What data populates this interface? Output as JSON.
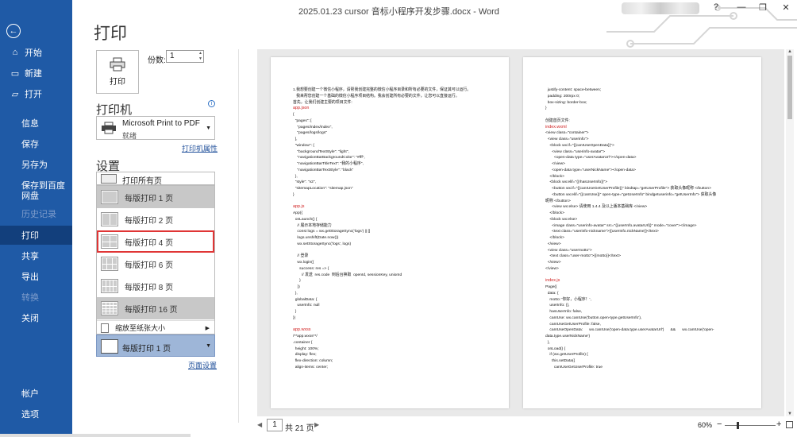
{
  "window": {
    "title": "2025.01.23  cursor 音标小程序开发步骤.docx  -  Word",
    "help": "?",
    "minimize": "—",
    "restore": "❐",
    "close": "✕"
  },
  "sidebar": {
    "back": "←",
    "items": [
      {
        "label": "开始",
        "icon": "home-icon",
        "glyph": "⌂"
      },
      {
        "label": "新建",
        "icon": "new-doc-icon",
        "glyph": "▭"
      },
      {
        "label": "打开",
        "icon": "folder-icon",
        "glyph": "▱"
      },
      {
        "label": "信息"
      },
      {
        "label": "保存"
      },
      {
        "label": "另存为"
      },
      {
        "label": "保存到百度网盘"
      },
      {
        "label": "历史记录"
      },
      {
        "label": "打印"
      },
      {
        "label": "共享"
      },
      {
        "label": "导出"
      },
      {
        "label": "转换"
      },
      {
        "label": "关闭"
      },
      {
        "label": "帐户"
      },
      {
        "label": "选项"
      }
    ]
  },
  "print": {
    "title": "打印",
    "button": "打印",
    "copies_label": "份数:",
    "copies_value": "1",
    "printer_section": "打印机",
    "printer_name": "Microsoft Print to PDF",
    "printer_status": "就绪",
    "printer_props": "打印机属性",
    "settings_section": "设置",
    "print_all": "打印所有页",
    "pages_per_sheet": [
      {
        "label": "每版打印 1 页",
        "grid": [
          1,
          1
        ]
      },
      {
        "label": "每版打印 2 页",
        "grid": [
          2,
          1
        ]
      },
      {
        "label": "每版打印 4 页",
        "grid": [
          2,
          2
        ]
      },
      {
        "label": "每版打印 6 页",
        "grid": [
          3,
          2
        ]
      },
      {
        "label": "每版打印 8 页",
        "grid": [
          4,
          2
        ]
      },
      {
        "label": "每版打印 16 页",
        "grid": [
          4,
          4
        ]
      }
    ],
    "selected_option": "每版打印 4 页",
    "scale_option": "缩放至纸张大小",
    "current_selection": "每版打印 1 页",
    "page_setup": "页面设置"
  },
  "preview": {
    "left_page": [
      {
        "t": "1.我想要创建一个微信小程序，请帮我创建完整的微信小程序目录和所有必要的文件，保证其可以运行。",
        "h": false
      },
      {
        "t": "   我来帮您创建一个基础的微信小程序项目结构。我会创建所有必要的文件，让您可以直接运行。",
        "h": false
      },
      {
        "t": "首先，让我们创建主要的项目文件:",
        "h": false
      },
      {
        "t": "app.json",
        "h": true
      },
      {
        "t": "{",
        "h": false
      },
      {
        "t": "  \"pages\": [",
        "h": false
      },
      {
        "t": "    \"pages/index/index\",",
        "h": false
      },
      {
        "t": "    \"pages/logs/logs\"",
        "h": false
      },
      {
        "t": "  ],",
        "h": false
      },
      {
        "t": "  \"window\": {",
        "h": false
      },
      {
        "t": "    \"backgroundTextStyle\": \"light\",",
        "h": false
      },
      {
        "t": "    \"navigationBarBackgroundColor\": \"#fff\",",
        "h": false
      },
      {
        "t": "    \"navigationBarTitleText\": \"我的小程序\",",
        "h": false
      },
      {
        "t": "    \"navigationBarTextStyle\": \"black\"",
        "h": false
      },
      {
        "t": "  },",
        "h": false
      },
      {
        "t": "  \"style\": \"v2\",",
        "h": false
      },
      {
        "t": "  \"sitemapLocation\": \"sitemap.json\"",
        "h": false
      },
      {
        "t": "}",
        "h": false
      },
      {
        "t": "",
        "h": false
      },
      {
        "t": "app.js",
        "h": true
      },
      {
        "t": "App({",
        "h": false
      },
      {
        "t": "  onLaunch() {",
        "h": false
      },
      {
        "t": "    // 展示本地存储能力",
        "h": false
      },
      {
        "t": "    const logs = wx.getStorageSync('logs') || []",
        "h": false
      },
      {
        "t": "    logs.unshift(Date.now())",
        "h": false
      },
      {
        "t": "    wx.setStorageSync('logs', logs)",
        "h": false
      },
      {
        "t": "",
        "h": false
      },
      {
        "t": "    // 登录",
        "h": false
      },
      {
        "t": "    wx.login({",
        "h": false
      },
      {
        "t": "      success: res => {",
        "h": false
      },
      {
        "t": "        // 发送  res.code  到后台换取  openId, sessionKey, unionId",
        "h": false
      },
      {
        "t": "      }",
        "h": false
      },
      {
        "t": "    })",
        "h": false
      },
      {
        "t": "  },",
        "h": false
      },
      {
        "t": "  globalData: {",
        "h": false
      },
      {
        "t": "    userInfo: null",
        "h": false
      },
      {
        "t": "  }",
        "h": false
      },
      {
        "t": "})",
        "h": false
      },
      {
        "t": "",
        "h": false
      },
      {
        "t": "app.wxss",
        "h": true
      },
      {
        "t": "/**app.wxss**/",
        "h": false
      },
      {
        "t": ".container {",
        "h": false
      },
      {
        "t": "  height: 100%;",
        "h": false
      },
      {
        "t": "  display: flex;",
        "h": false
      },
      {
        "t": "  flex-direction: column;",
        "h": false
      },
      {
        "t": "  align-items: center;",
        "h": false
      }
    ],
    "right_page": [
      {
        "t": "  justify-content: space-between;",
        "h": false
      },
      {
        "t": "  padding: 200rpx 0;",
        "h": false
      },
      {
        "t": "  box-sizing: border-box;",
        "h": false
      },
      {
        "t": "}",
        "h": false
      },
      {
        "t": "",
        "h": false
      },
      {
        "t": "创建首页文件:",
        "h": false
      },
      {
        "t": "index.wxml",
        "h": true
      },
      {
        "t": "<view class=\"container\">",
        "h": false
      },
      {
        "t": "  <view class=\"userinfo\">",
        "h": false
      },
      {
        "t": "    <block wx:if=\"{{canIUseOpenData}}\">",
        "h": false
      },
      {
        "t": "      <view class=\"userinfo-avatar\">",
        "h": false
      },
      {
        "t": "        <open-data type=\"userAvatarUrl\"></open-data>",
        "h": false
      },
      {
        "t": "      </view>",
        "h": false
      },
      {
        "t": "      <open-data type=\"userNickName\"></open-data>",
        "h": false
      },
      {
        "t": "    </block>",
        "h": false
      },
      {
        "t": "    <block wx:elif=\"{{!hasUserInfo}}\">",
        "h": false
      },
      {
        "t": "      <button wx:if=\"{{canIUseGetUserProfile}}\" bindtap=\"getUserProfile\"> 获取头像昵称 </button>",
        "h": false
      },
      {
        "t": "      <button wx:elif=\"{{canIUse}}\" open-type=\"getUserInfo\" bindgetuserinfo=\"getUserInfo\"> 获取头像",
        "h": false
      },
      {
        "t": "昵称 </button>",
        "h": false
      },
      {
        "t": "      <view wx:else> 请使用 1.4.4 及以上版本基础库 </view>",
        "h": false
      },
      {
        "t": "    </block>",
        "h": false
      },
      {
        "t": "    <block wx:else>",
        "h": false
      },
      {
        "t": "      <image class=\"userinfo-avatar\" src=\"{{userInfo.avatarUrl}}\" mode=\"cover\"></image>",
        "h": false
      },
      {
        "t": "      <text class=\"userinfo-nickname\">{{userInfo.nickName}}</text>",
        "h": false
      },
      {
        "t": "    </block>",
        "h": false
      },
      {
        "t": "  </view>",
        "h": false
      },
      {
        "t": "  <view class=\"usermotto\">",
        "h": false
      },
      {
        "t": "    <text class=\"user-motto\">{{motto}}</text>",
        "h": false
      },
      {
        "t": "  </view>",
        "h": false
      },
      {
        "t": "</view>",
        "h": false
      },
      {
        "t": "",
        "h": false
      },
      {
        "t": "index.js",
        "h": true
      },
      {
        "t": "Page({",
        "h": false
      },
      {
        "t": "  data: {",
        "h": false
      },
      {
        "t": "    motto: '你好，小程序！',",
        "h": false
      },
      {
        "t": "    userInfo: {},",
        "h": false
      },
      {
        "t": "    hasUserInfo: false,",
        "h": false
      },
      {
        "t": "    canIUse: wx.canIUse('button.open-type.getUserInfo'),",
        "h": false
      },
      {
        "t": "    canIUseGetUserProfile: false,",
        "h": false
      },
      {
        "t": "    canIUseOpenData:      wx.canIUse('open-data.type.userAvatarUrl')      &&      wx.canIUse('open-",
        "h": false
      },
      {
        "t": "data.type.userNickName')",
        "h": false
      },
      {
        "t": "  },",
        "h": false
      },
      {
        "t": "  onLoad() {",
        "h": false
      },
      {
        "t": "    if (wx.getUserProfile) {",
        "h": false
      },
      {
        "t": "      this.setData({",
        "h": false
      },
      {
        "t": "        canIUseGetUserProfile: true",
        "h": false
      }
    ]
  },
  "footer": {
    "current_page": "1",
    "total": "共 21 页",
    "zoom": "60%",
    "zoom_minus": "−",
    "zoom_plus": "+"
  },
  "colors": {
    "sidebar": "#1f5aa6",
    "sidebar_active": "#123f7c",
    "selection_outline": "#e03535",
    "code_heading": "#d02020"
  }
}
